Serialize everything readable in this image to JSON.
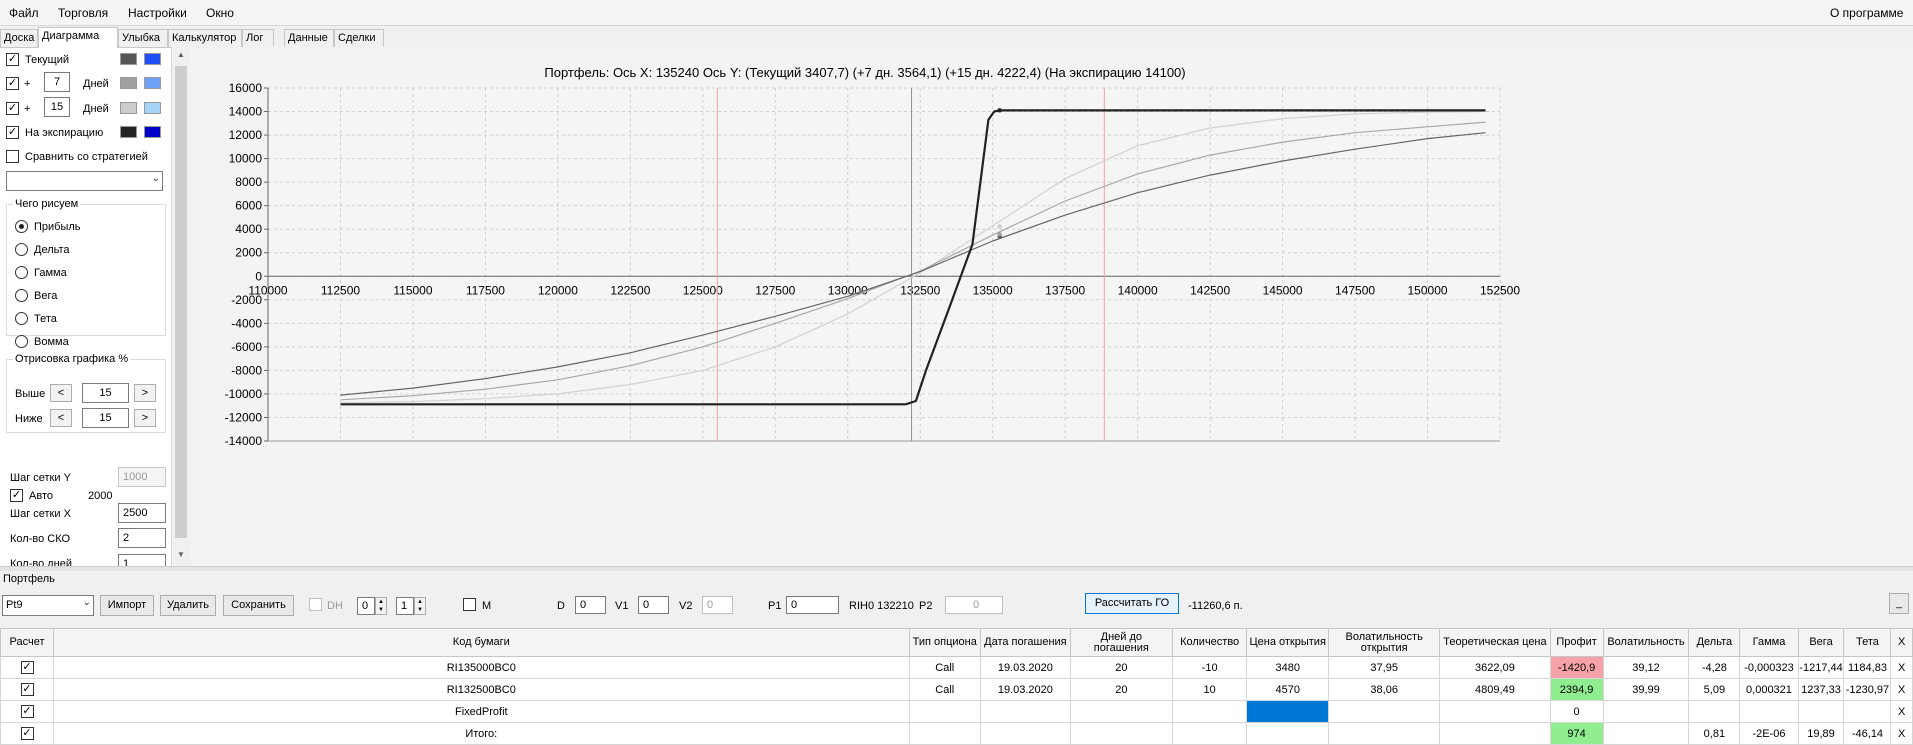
{
  "menu": {
    "items": [
      "Файл",
      "Торговля",
      "Настройки",
      "Окно"
    ],
    "about": "О программе"
  },
  "tabs": [
    "Доска",
    "Диаграмма",
    "Улыбка",
    "Калькулятор",
    "Лог",
    "Данные",
    "Сделки"
  ],
  "active_tab": "Диаграмма",
  "left_panel": {
    "current_label": "Текущий",
    "plus_label": "+",
    "days_label": "Дней",
    "days1": "7",
    "days2": "15",
    "expiry_label": "На экспирацию",
    "compare_label": "Сравнить со стратегией",
    "what_draw_title": "Чего рисуем",
    "radio_options": [
      "Прибыль",
      "Дельта",
      "Гамма",
      "Вега",
      "Тета",
      "Вомма"
    ],
    "selected_radio": "Прибыль",
    "render_title": "Отрисовка графика %",
    "above_label": "Выше",
    "below_label": "Ниже",
    "above_value": "15",
    "below_value": "15",
    "btn_less": "<",
    "btn_more": ">",
    "grid_y_label": "Шаг сетки Y",
    "grid_y_value": "1000",
    "auto_label": "Авто",
    "auto_value": "2000",
    "grid_x_label": "Шаг сетки X",
    "grid_x_value": "2500",
    "sko_label": "Кол-во СКО",
    "sko_value": "2",
    "days_count_label": "Кол-во дней",
    "days_count_value": "1",
    "colors": {
      "current_dark": "#555555",
      "current_blue": "#1f4ff5",
      "d7_dark": "#a0a0a0",
      "d7_blue": "#6ea0f5",
      "d15_dark": "#cccccc",
      "d15_blue": "#a8d4f8",
      "exp_dark": "#222222",
      "exp_blue": "#0000c8"
    }
  },
  "chart_data": {
    "type": "line",
    "title": "Портфель: Ось X: 135240 Ось Y: (Текущий 3407,7) (+7 дн. 3564,1) (+15 дн. 4222,4) (На экспирацию 14100)",
    "x_ticks": [
      "110000",
      "112500",
      "115000",
      "117500",
      "120000",
      "122500",
      "125000",
      "127500",
      "130000",
      "132500",
      "135000",
      "137500",
      "140000",
      "142500",
      "145000",
      "147500",
      "150000",
      "152500"
    ],
    "y_ticks": [
      "16000",
      "14000",
      "12000",
      "10000",
      "8000",
      "6000",
      "4000",
      "2000",
      "0",
      "-2000",
      "-4000",
      "-6000",
      "-8000",
      "-10000",
      "-12000",
      "-14000"
    ],
    "xlim": [
      110000,
      152500
    ],
    "ylim": [
      -14000,
      16000
    ],
    "grid": true,
    "vertical_markers": [
      {
        "x": 125500,
        "color": "#f3a3a3"
      },
      {
        "x": 132200,
        "color": "#909090"
      },
      {
        "x": 138850,
        "color": "#f3a3a3"
      }
    ],
    "series": [
      {
        "color": "#222222",
        "width": 2.2,
        "points": [
          [
            112500,
            -10880
          ],
          [
            132000,
            -10880
          ],
          [
            132350,
            -10600
          ],
          [
            132700,
            -8000
          ],
          [
            133500,
            -2700
          ],
          [
            134300,
            2700
          ],
          [
            134850,
            13300
          ],
          [
            135050,
            14000
          ],
          [
            135240,
            14100
          ],
          [
            152000,
            14100
          ]
        ]
      },
      {
        "color": "#666666",
        "width": 1.2,
        "points": [
          [
            112500,
            -10100
          ],
          [
            115000,
            -9500
          ],
          [
            117500,
            -8700
          ],
          [
            120000,
            -7700
          ],
          [
            122500,
            -6500
          ],
          [
            125000,
            -5000
          ],
          [
            127500,
            -3400
          ],
          [
            130000,
            -1700
          ],
          [
            132500,
            400
          ],
          [
            135000,
            3000
          ],
          [
            137500,
            5200
          ],
          [
            140000,
            7100
          ],
          [
            142500,
            8600
          ],
          [
            145000,
            9800
          ],
          [
            147500,
            10800
          ],
          [
            150000,
            11700
          ],
          [
            152000,
            12200
          ]
        ]
      },
      {
        "color": "#a8a8a8",
        "width": 1.2,
        "points": [
          [
            112500,
            -10500
          ],
          [
            115000,
            -10150
          ],
          [
            117500,
            -9600
          ],
          [
            120000,
            -8800
          ],
          [
            122500,
            -7600
          ],
          [
            125000,
            -6000
          ],
          [
            127500,
            -4000
          ],
          [
            130000,
            -1900
          ],
          [
            132500,
            450
          ],
          [
            135000,
            3500
          ],
          [
            137500,
            6400
          ],
          [
            140000,
            8700
          ],
          [
            142500,
            10300
          ],
          [
            145000,
            11400
          ],
          [
            147500,
            12200
          ],
          [
            150000,
            12700
          ],
          [
            152000,
            13100
          ]
        ]
      },
      {
        "color": "#d2d2d2",
        "width": 1.2,
        "points": [
          [
            112500,
            -10750
          ],
          [
            115000,
            -10650
          ],
          [
            117500,
            -10400
          ],
          [
            120000,
            -10000
          ],
          [
            122500,
            -9200
          ],
          [
            125000,
            -8000
          ],
          [
            127500,
            -6000
          ],
          [
            130000,
            -3200
          ],
          [
            132500,
            300
          ],
          [
            135000,
            4300
          ],
          [
            137500,
            8300
          ],
          [
            140000,
            11100
          ],
          [
            142500,
            12600
          ],
          [
            145000,
            13400
          ],
          [
            147500,
            13800
          ],
          [
            150000,
            13950
          ],
          [
            152000,
            14000
          ]
        ]
      }
    ],
    "markers": [
      {
        "x": 135240,
        "y": 14100,
        "color": "#222222"
      },
      {
        "x": 135240,
        "y": 3408,
        "color": "#555555"
      },
      {
        "x": 135240,
        "y": 3564,
        "color": "#a0a0a0"
      },
      {
        "x": 135240,
        "y": 4222,
        "color": "#cccccc"
      }
    ]
  },
  "portfolio": {
    "section_label": "Портфель",
    "selected": "Pt9",
    "import_label": "Импорт",
    "delete_label": "Удалить",
    "save_label": "Сохранить",
    "dh_label": "DH",
    "spin1": "0",
    "spin2": "1",
    "m_label": "M",
    "d_label": "D",
    "d_value": "0",
    "v1_label": "V1",
    "v1_value": "0",
    "v2_label": "V2",
    "v2_value": "0",
    "p1_label": "P1",
    "p1_value": "0",
    "rih_label": "RIH0 132210",
    "p2_label": "P2",
    "p2_value": "0",
    "calc_go_label": "Рассчитать ГО",
    "go_value": "-11260,6 п.",
    "minimize_label": "_"
  },
  "table": {
    "headers": [
      "Расчет",
      "Код бумаги",
      "Тип опциона",
      "Дата погашения",
      "Дней до погашения",
      "Количество",
      "Цена открытия",
      "Волатильность открытия",
      "Теоретическая цена",
      "Профит",
      "Волатильность",
      "Дельта",
      "Гамма",
      "Вега",
      "Тета",
      "X"
    ],
    "rows": [
      {
        "code": "RI135000BC0",
        "type": "Call",
        "date": "19.03.2020",
        "days": "20",
        "qty": "-10",
        "price": "3480",
        "vol_open": "37,95",
        "theo": "3622,09",
        "profit": "-1420,9",
        "vol": "39,12",
        "delta": "-4,28",
        "gamma": "-0,000323",
        "vega": "-1217,44",
        "theta": "1184,83",
        "x": "X"
      },
      {
        "code": "RI132500BC0",
        "type": "Call",
        "date": "19.03.2020",
        "days": "20",
        "qty": "10",
        "price": "4570",
        "vol_open": "38,06",
        "theo": "4809,49",
        "profit": "2394,9",
        "vol": "39,99",
        "delta": "5,09",
        "gamma": "0,000321",
        "vega": "1237,33",
        "theta": "-1230,97",
        "x": "X"
      },
      {
        "code": "FixedProfit",
        "type": "",
        "date": "",
        "days": "",
        "qty": "",
        "price": "",
        "vol_open": "",
        "theo": "",
        "profit": "0",
        "vol": "",
        "delta": "",
        "gamma": "",
        "vega": "",
        "theta": "",
        "x": "X"
      },
      {
        "code": "Итого:",
        "type": "",
        "date": "",
        "days": "",
        "qty": "",
        "price": "",
        "vol_open": "",
        "theo": "",
        "profit": "974",
        "vol": "",
        "delta": "0,81",
        "gamma": "-2E-06",
        "vega": "19,89",
        "theta": "-46,14",
        "x": "X"
      }
    ]
  }
}
